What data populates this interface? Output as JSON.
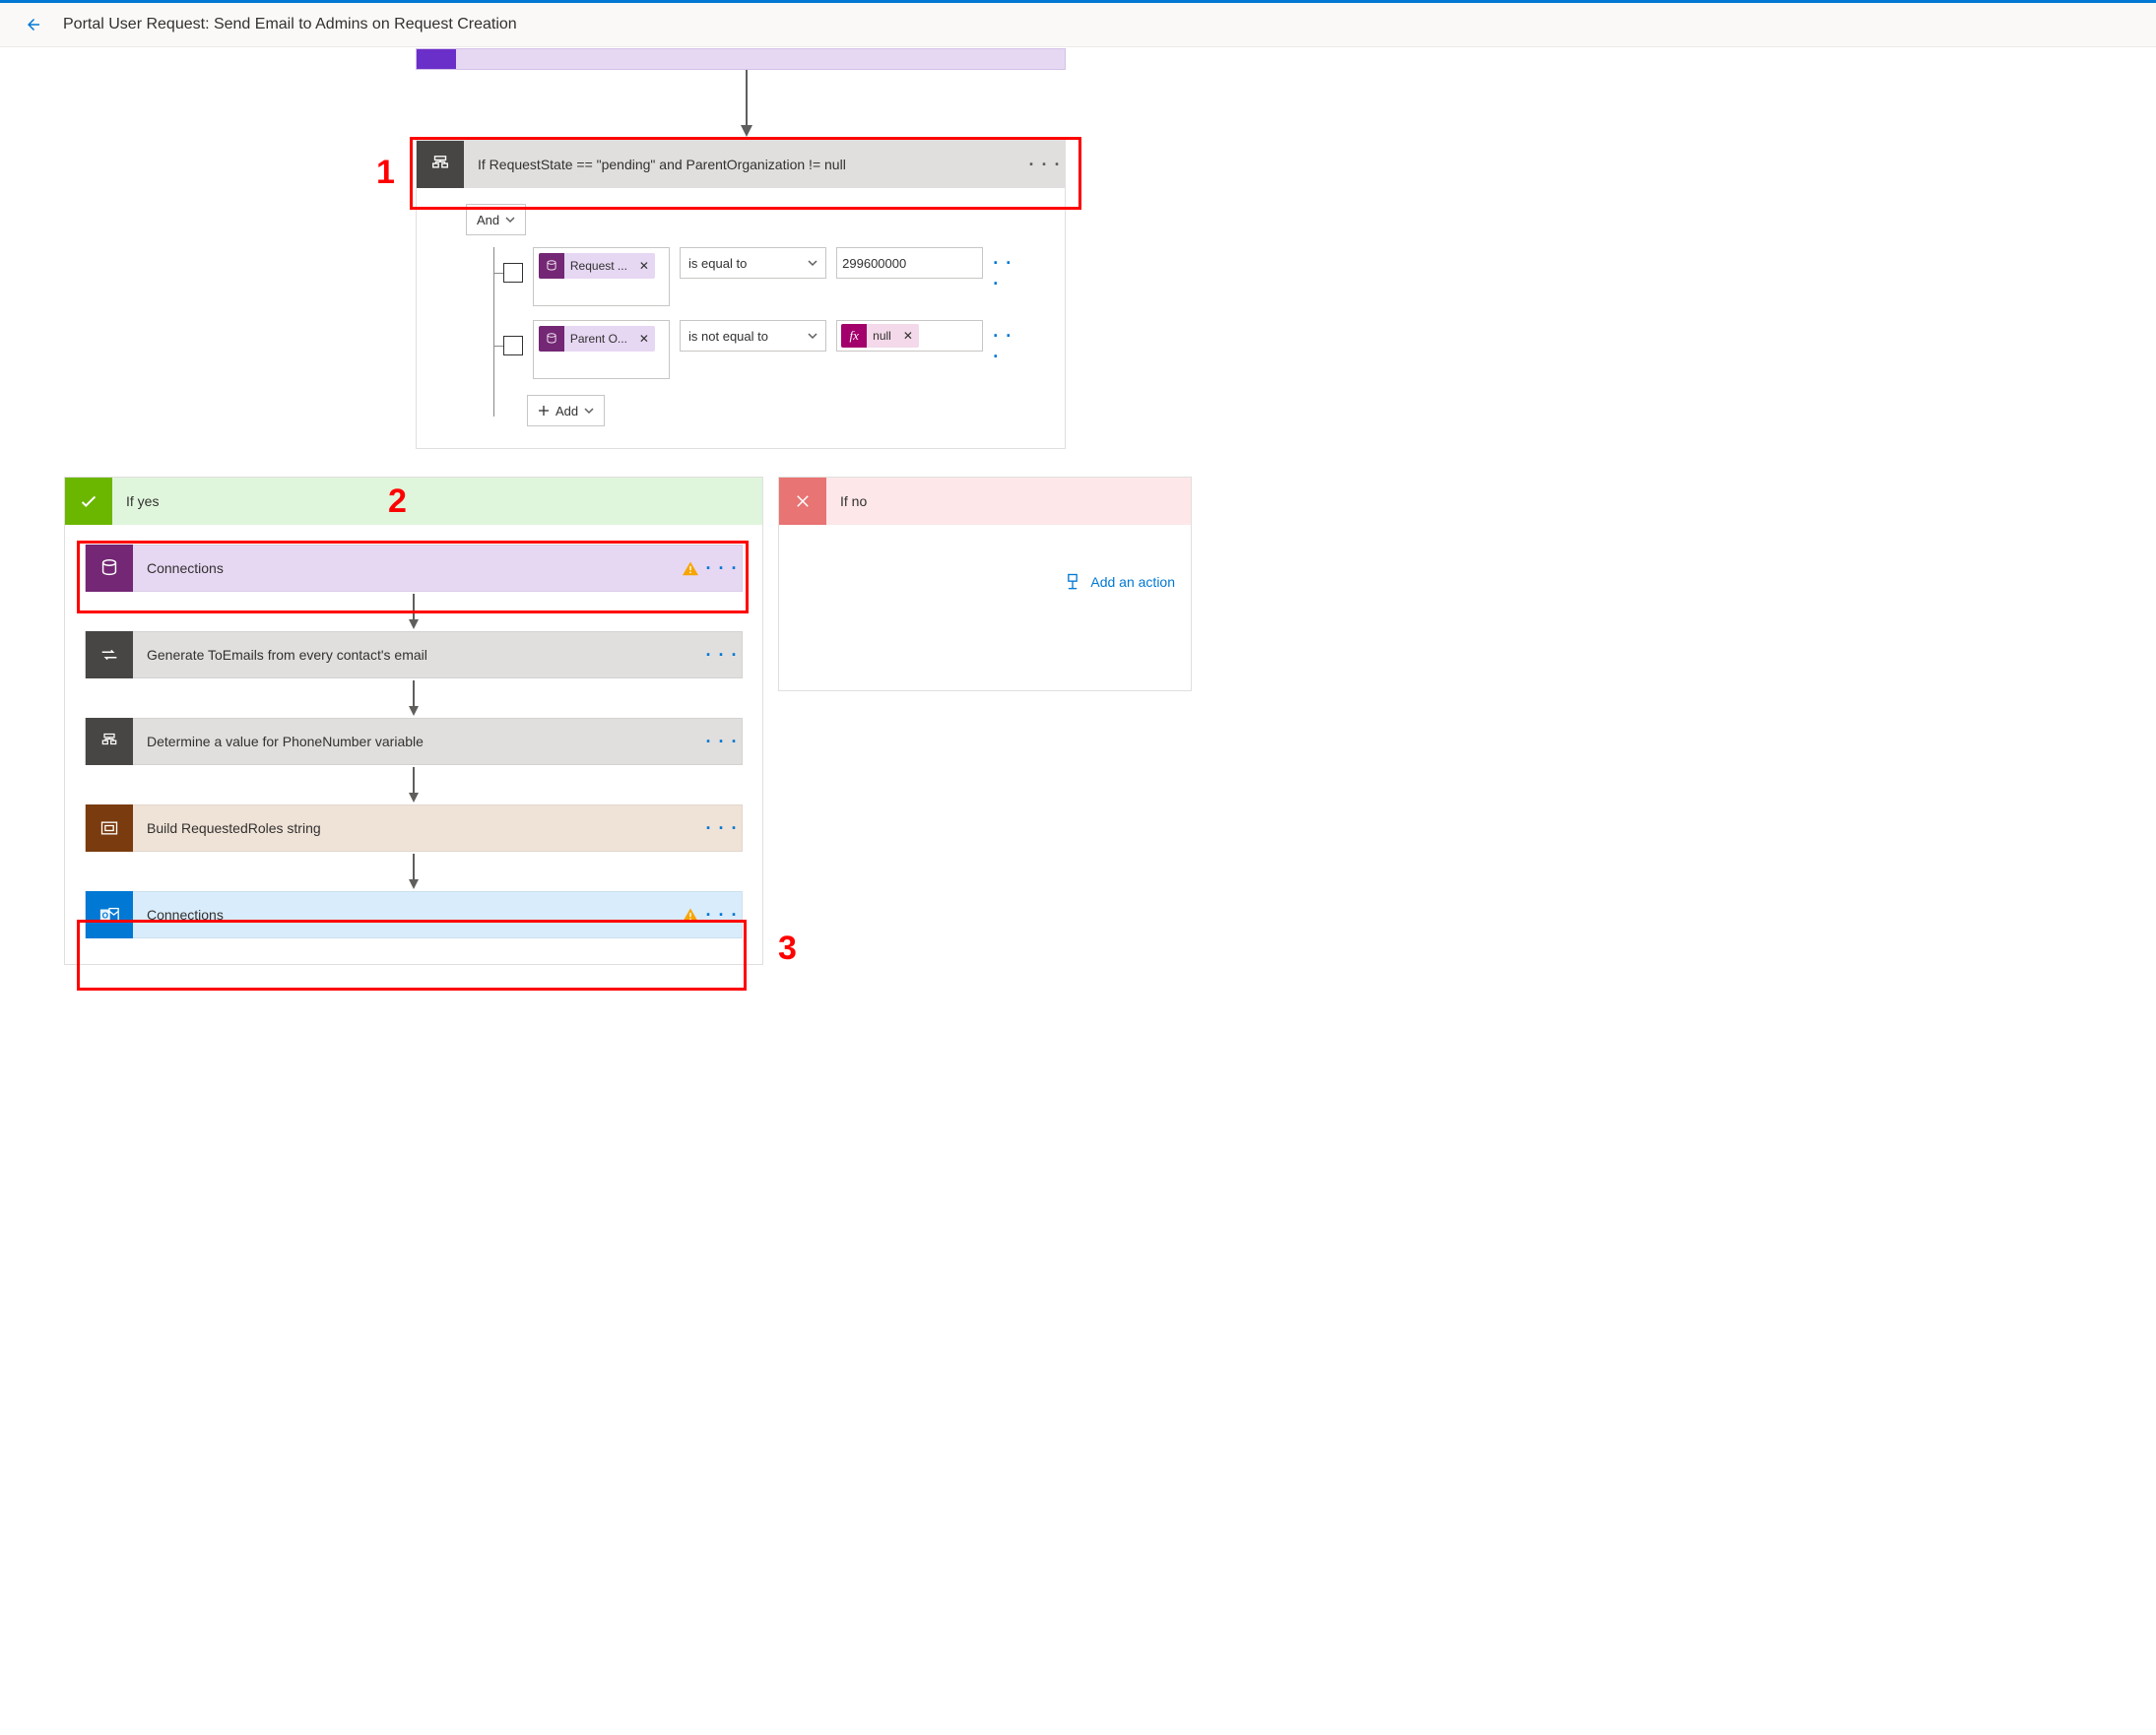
{
  "header": {
    "title": "Portal User Request: Send Email to Admins on Request Creation"
  },
  "condition": {
    "title": "If RequestState == \"pending\" and ParentOrganization != null",
    "group_op": "And",
    "rows": [
      {
        "field_token": "Request ...",
        "operator": "is equal to",
        "value_text": "299600000",
        "value_is_token": false
      },
      {
        "field_token": "Parent O...",
        "operator": "is not equal to",
        "value_text": "null",
        "value_is_token": true
      }
    ],
    "add_label": "Add"
  },
  "branch_yes": {
    "title": "If yes",
    "steps": [
      {
        "label": "Connections",
        "style": "purple",
        "warn": true
      },
      {
        "label": "Generate ToEmails from every contact's email",
        "style": "gray",
        "icon": "loop",
        "warn": false
      },
      {
        "label": "Determine a value for PhoneNumber variable",
        "style": "gray",
        "icon": "cond",
        "warn": false
      },
      {
        "label": "Build RequestedRoles string",
        "style": "brown",
        "warn": false
      },
      {
        "label": "Connections",
        "style": "blue",
        "warn": true
      }
    ]
  },
  "branch_no": {
    "title": "If no",
    "add_action_label": "Add an action"
  },
  "annotations": {
    "n1": "1",
    "n2": "2",
    "n3": "3"
  }
}
